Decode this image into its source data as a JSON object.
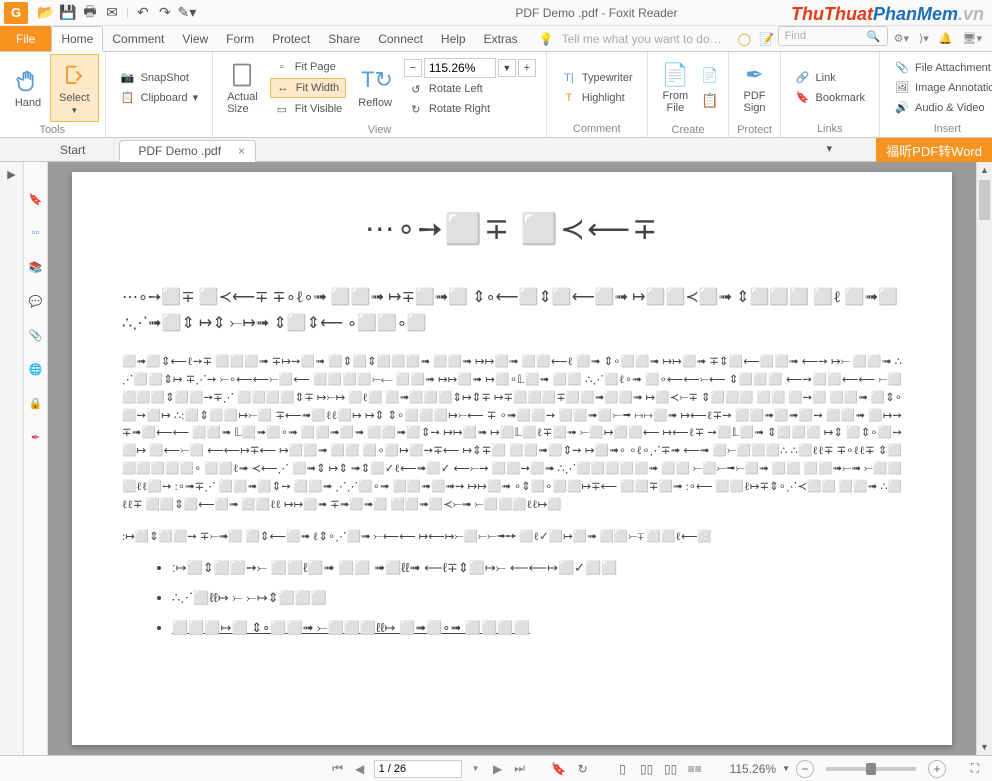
{
  "app": {
    "logo_letter": "G",
    "title": "PDF Demo .pdf - Foxit Reader"
  },
  "watermark": {
    "part1": "ThuThuat",
    "part2": "PhanMem",
    "part3": ".vn"
  },
  "menu": {
    "file": "File",
    "tabs": [
      "Home",
      "Comment",
      "View",
      "Form",
      "Protect",
      "Share",
      "Connect",
      "Help",
      "Extras"
    ],
    "tellme": "Tell me what you want to do…",
    "find": "Find"
  },
  "ribbon": {
    "hand": "Hand",
    "select": "Select",
    "tools_label": "Tools",
    "snapshot": "SnapShot",
    "clipboard": "Clipboard",
    "actual_size": "Actual\nSize",
    "fit_page": "Fit Page",
    "fit_width": "Fit Width",
    "fit_visible": "Fit Visible",
    "reflow": "Reflow",
    "zoom_value": "115.26%",
    "rotate_left": "Rotate Left",
    "rotate_right": "Rotate Right",
    "view_label": "View",
    "typewriter": "Typewriter",
    "highlight": "Highlight",
    "comment_label": "Comment",
    "from_file": "From\nFile",
    "create_label": "Create",
    "pdf_sign": "PDF\nSign",
    "protect_label": "Protect",
    "link": "Link",
    "bookmark": "Bookmark",
    "links_label": "Links",
    "file_attachment": "File Attachment",
    "image_annotation": "Image Annotation",
    "audio_video": "Audio & Video",
    "insert_label": "Insert"
  },
  "doctabs": {
    "start": "Start",
    "doc": "PDF Demo .pdf",
    "convert": "福昕PDF转Word"
  },
  "pdf": {
    "title": "⋯∘➙⬜∓ ⬜≺⟵∓",
    "lead": "⋯∘➙⬜∓ ⬜≺⟵∓ ∓∘ℓ∘➟ ⬜⬜➟ ↦∓⬜➟⬜ ⇕∘⟵⬜⇕⬜⟵⬜➟ ↦⬜⬜≺⬜➟ ⇕⬜⬜⬜ ⬜ℓ ⬜➟⬜ ∴⋰➟⬜⇕ ↦⇕ ⤚↦➟ ⇕⬜⇕⟵ ∘⬜⬜∘⬜",
    "body": "⬜➟⬜⇕⟵ℓ➙∓ ⬜⬜⬜➟ ∓↦➙⬜➟ ⬜⇕⬜⇕⬜⬜⬜➟ ⬜⬜➟ ↦↦⬜➟ ⬜⬜⟵ℓ ⬜➟ ⇕∘⬜⬜➟ ↦↦⬜➟ ∓⇕⬜⟵⬜⬜➟ ⟵➙ ↦⤚ ⬜⬜➟ ∴⋰⬜⬜⇕↦ ∓⋰➙ ⤚∘⟵⟵⤚⬜⟵ ⬜⬜⬜⬜⤚⟵ ⬜⬜➟ ↦↦⬜➟ ↦⬜∘𝕃⬜➟ ⬜⬜ ∴⋰⬜ℓ∘➟ ⬜∘⟵⟵⤚⟵ ⇕⬜⬜⬜ ⟵➙⬜⬜⟵⟵ ⤚⬜ ⬜⬜⬜⇕⬜⬜➙∓⋰ ⬜⬜⬜⬜⇕∓ ↦⤚↦ ⬜ℓ⬜ ⬜➟⬜⬜⬜⇕↦⇕∓ ↦∓⬜⬜⬜∓⬜⬜➟⬜⬜➟ ↦⬜≺⤚∓ ⇕⬜⬜⬜ ⬜⬜ ⬜➙⬜ ⬜⬜➟ ⬜⇕∘⬜➙⬜↦ ∴:⬜⇕⬜⬜↦⤚⬜ ∓⟵➟⬜ℓℓ⬜↦ ↦⇕ ⇕∘⬜⬜⬜↦⤚⟵ ∓ ∘➟⬜⬜➙ ⬜⬜➟⬜⤚➟ ↦↦⬜➟ ↦⟵ℓ∓➙ ⬜⬜➟⬜➟⬜➙ ⬜⬜➟ ⬜↦➙ ∓➟⬜⟵⟵ ⬜⬜➟ 𝕃⬜➟⬜∘➟ ⬜⬜➟⬜➟ ⬜⬜➟⬜⇕➙ ↦↦⬜➟ ↦⬜𝕃⬜ℓ∓⬜➟ ⤚⬜↦⬜⬜⟵ ↦⟵ℓ∓ ➙⬜𝕃⬜➟ ⇕⬜⬜⬜ ↦⇕ ⬜⇕∘⬜➙⬜↦ ⬜⟵⤚⬜ ⟵⟵↦∓⟵ ↦⬜⬜➟ ⬜⬜ ⬜∘⬜↦⬜➙∓⟵ ↦⇕∓⬜ ⬜⬜➟⬜⇕➙ ↦⬜➟∘ ∘ℓ∘⋰∓➟ ⟵➟ ⬜⤚⬜⬜⬜∴ ∴⬜ℓℓ∓ ∓∘ℓℓ∓ ⇕⬜⬜⬜⬜⬜⬜∘ ⬜⬜ℓ➟ ≺⟵⋰ ⬜➟⇕ ↦⇕ ➟⇕⬜✓ℓ⟵➟⬜✓ ⟵⤚➙ ⬜⬜➙⬜➟ ∴⋰⬜⬜⬜⬜⬜➟ ⬜⬜ ⤚⬜⤚➟⤚⬜➟ ⬜⬜ ⬜⬜➟⤚➟ ⤚⬜⬜⬜ℓℓ⬜➙ :∘➟∓⋰ ⬜⬜➟⬜⇕➙ ⬜⬜➟ ⋰⋰⬜∘➟ ⬜⬜➟⬜➟➙ ↦↦⬜➟ ∘⇕⬜∘⬜⬜↦∓⟵ ⬜⬜∓⬜➟ :∘⟵ ⬜⬜ℓ↦∓⇕∘⋰≺⬜⬜ ⬜⬜➟ ∴⬜ℓℓ∓ ⬜⬜⇕⬜⟵⬜➟ ⬜⬜ℓℓ ↦↦⬜➟ ∓➟⬜➟⬜ ⬜⬜➟⬜≺⤚➟ ⤚⬜⬜⬜ℓℓ↦⬜",
    "para2": ":↦⬜⇕⬜⬜➙ ∓⤚➟⬜ ⬜⇕⟵⬜➟ ℓ⇕∘⋰⬜➟ ⤚⟵⟵ ↦⟵↦⤚⬜⤚⤚➟➙ ⬜ℓ✓⬜↦⬜➟ ⬜⬜⤚∓ ⬜⬜ℓ⟵⬜",
    "b1": ":↦⬜⇕⬜⬜➙⤚ ⬜⬜ℓ⬜➟ ⬜⬜ ➟⬜ℓℓ➟ ⟵ℓ∓⇕⬜↦⤚ ⟵⟵↦⬜✓⬜⬜",
    "b2": "∴⋰⬜ℓℓ↦ ⤚ ⤚↦⇕⬜⬜⬜",
    "b3": "⬜⬜⬜↦⬜ ⇕∘⬜⬜➟ ⤚⬜⬜⬜ℓℓ↦ ⬜➟⬜∘➟ ⬜⬜⬜⬜"
  },
  "status": {
    "page_input": "1 / 26",
    "zoom": "115.26%"
  }
}
